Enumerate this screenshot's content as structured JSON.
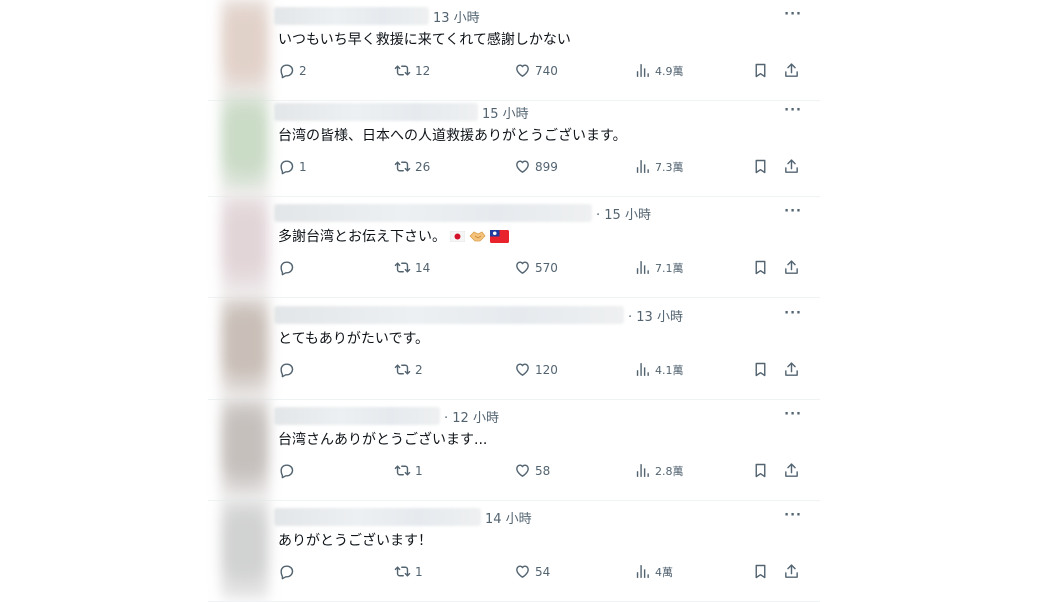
{
  "colors": {
    "accent": "#1d9bf0",
    "muted": "#536471",
    "text": "#0f1419",
    "divider": "#eff3f4"
  },
  "tweets": [
    {
      "time": "13 小時",
      "text": "いつもいち早く救援に来てくれて感謝しかない",
      "replies": "2",
      "retweets": "12",
      "likes": "740",
      "views": "4.9萬",
      "avatar_color": "#d8c3b8"
    },
    {
      "time": "15 小時",
      "text": "台湾の皆様、日本への人道救援ありがとうございます。",
      "replies": "1",
      "retweets": "26",
      "likes": "899",
      "views": "7.3萬",
      "avatar_color": "#b9cfb4"
    },
    {
      "time": "· 15 小時",
      "text": "多謝台湾とお伝え下さい。",
      "emojis": [
        "flag-japan-icon",
        "handshake-icon",
        "flag-taiwan-icon"
      ],
      "replies": "",
      "retweets": "14",
      "likes": "570",
      "views": "7.1萬",
      "avatar_color": "#d9c8cc"
    },
    {
      "time": "· 13 小時",
      "text": "とてもありがたいです。",
      "replies": "",
      "retweets": "2",
      "likes": "120",
      "views": "4.1萬",
      "avatar_color": "#b8aaa1"
    },
    {
      "time": "· 12 小時",
      "text": "台湾さんありがとうございます...",
      "replies": "",
      "retweets": "1",
      "likes": "58",
      "views": "2.8萬",
      "avatar_color": "#b3aca8"
    },
    {
      "time": "14 小時",
      "text": "ありがとうございます！",
      "replies": "",
      "retweets": "1",
      "likes": "54",
      "views": "4萬",
      "avatar_color": "#c2c4c3"
    }
  ],
  "icons": {
    "reply": "reply-icon",
    "retweet": "retweet-icon",
    "like": "heart-icon",
    "views": "views-icon",
    "bookmark": "bookmark-icon",
    "share": "share-icon",
    "more": "more-icon"
  },
  "more_label": "···"
}
